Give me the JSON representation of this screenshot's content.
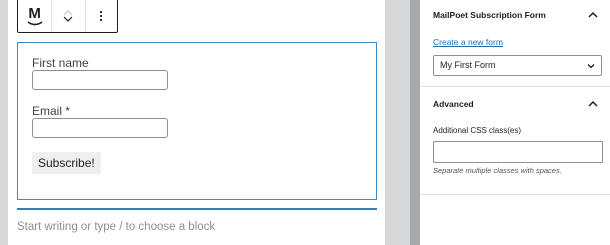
{
  "toolbar": {
    "block_icon": "mailpoet-logo-icon",
    "logo_letter": "M",
    "move_up_icon": "chevron-up-icon",
    "move_down_icon": "chevron-down-icon",
    "more_icon": "more-vertical-icon"
  },
  "form": {
    "fields": [
      {
        "label": "First name",
        "value": ""
      },
      {
        "label": "Email *",
        "value": ""
      }
    ],
    "submit_label": "Subscribe!"
  },
  "appender": {
    "placeholder": "Start writing or type / to choose a block"
  },
  "sidebar": {
    "subscription_panel": {
      "title": "MailPoet Subscription Form",
      "create_link": "Create a new form",
      "selected_form": "My First Form"
    },
    "advanced_panel": {
      "title": "Advanced",
      "css_label": "Additional CSS class(es)",
      "css_value": "",
      "css_help": "Separate multiple classes with spaces."
    }
  },
  "colors": {
    "accent_blue": "#3a8fc6",
    "link_blue": "#2271b1",
    "gutter_gray": "#d6d7d9"
  }
}
